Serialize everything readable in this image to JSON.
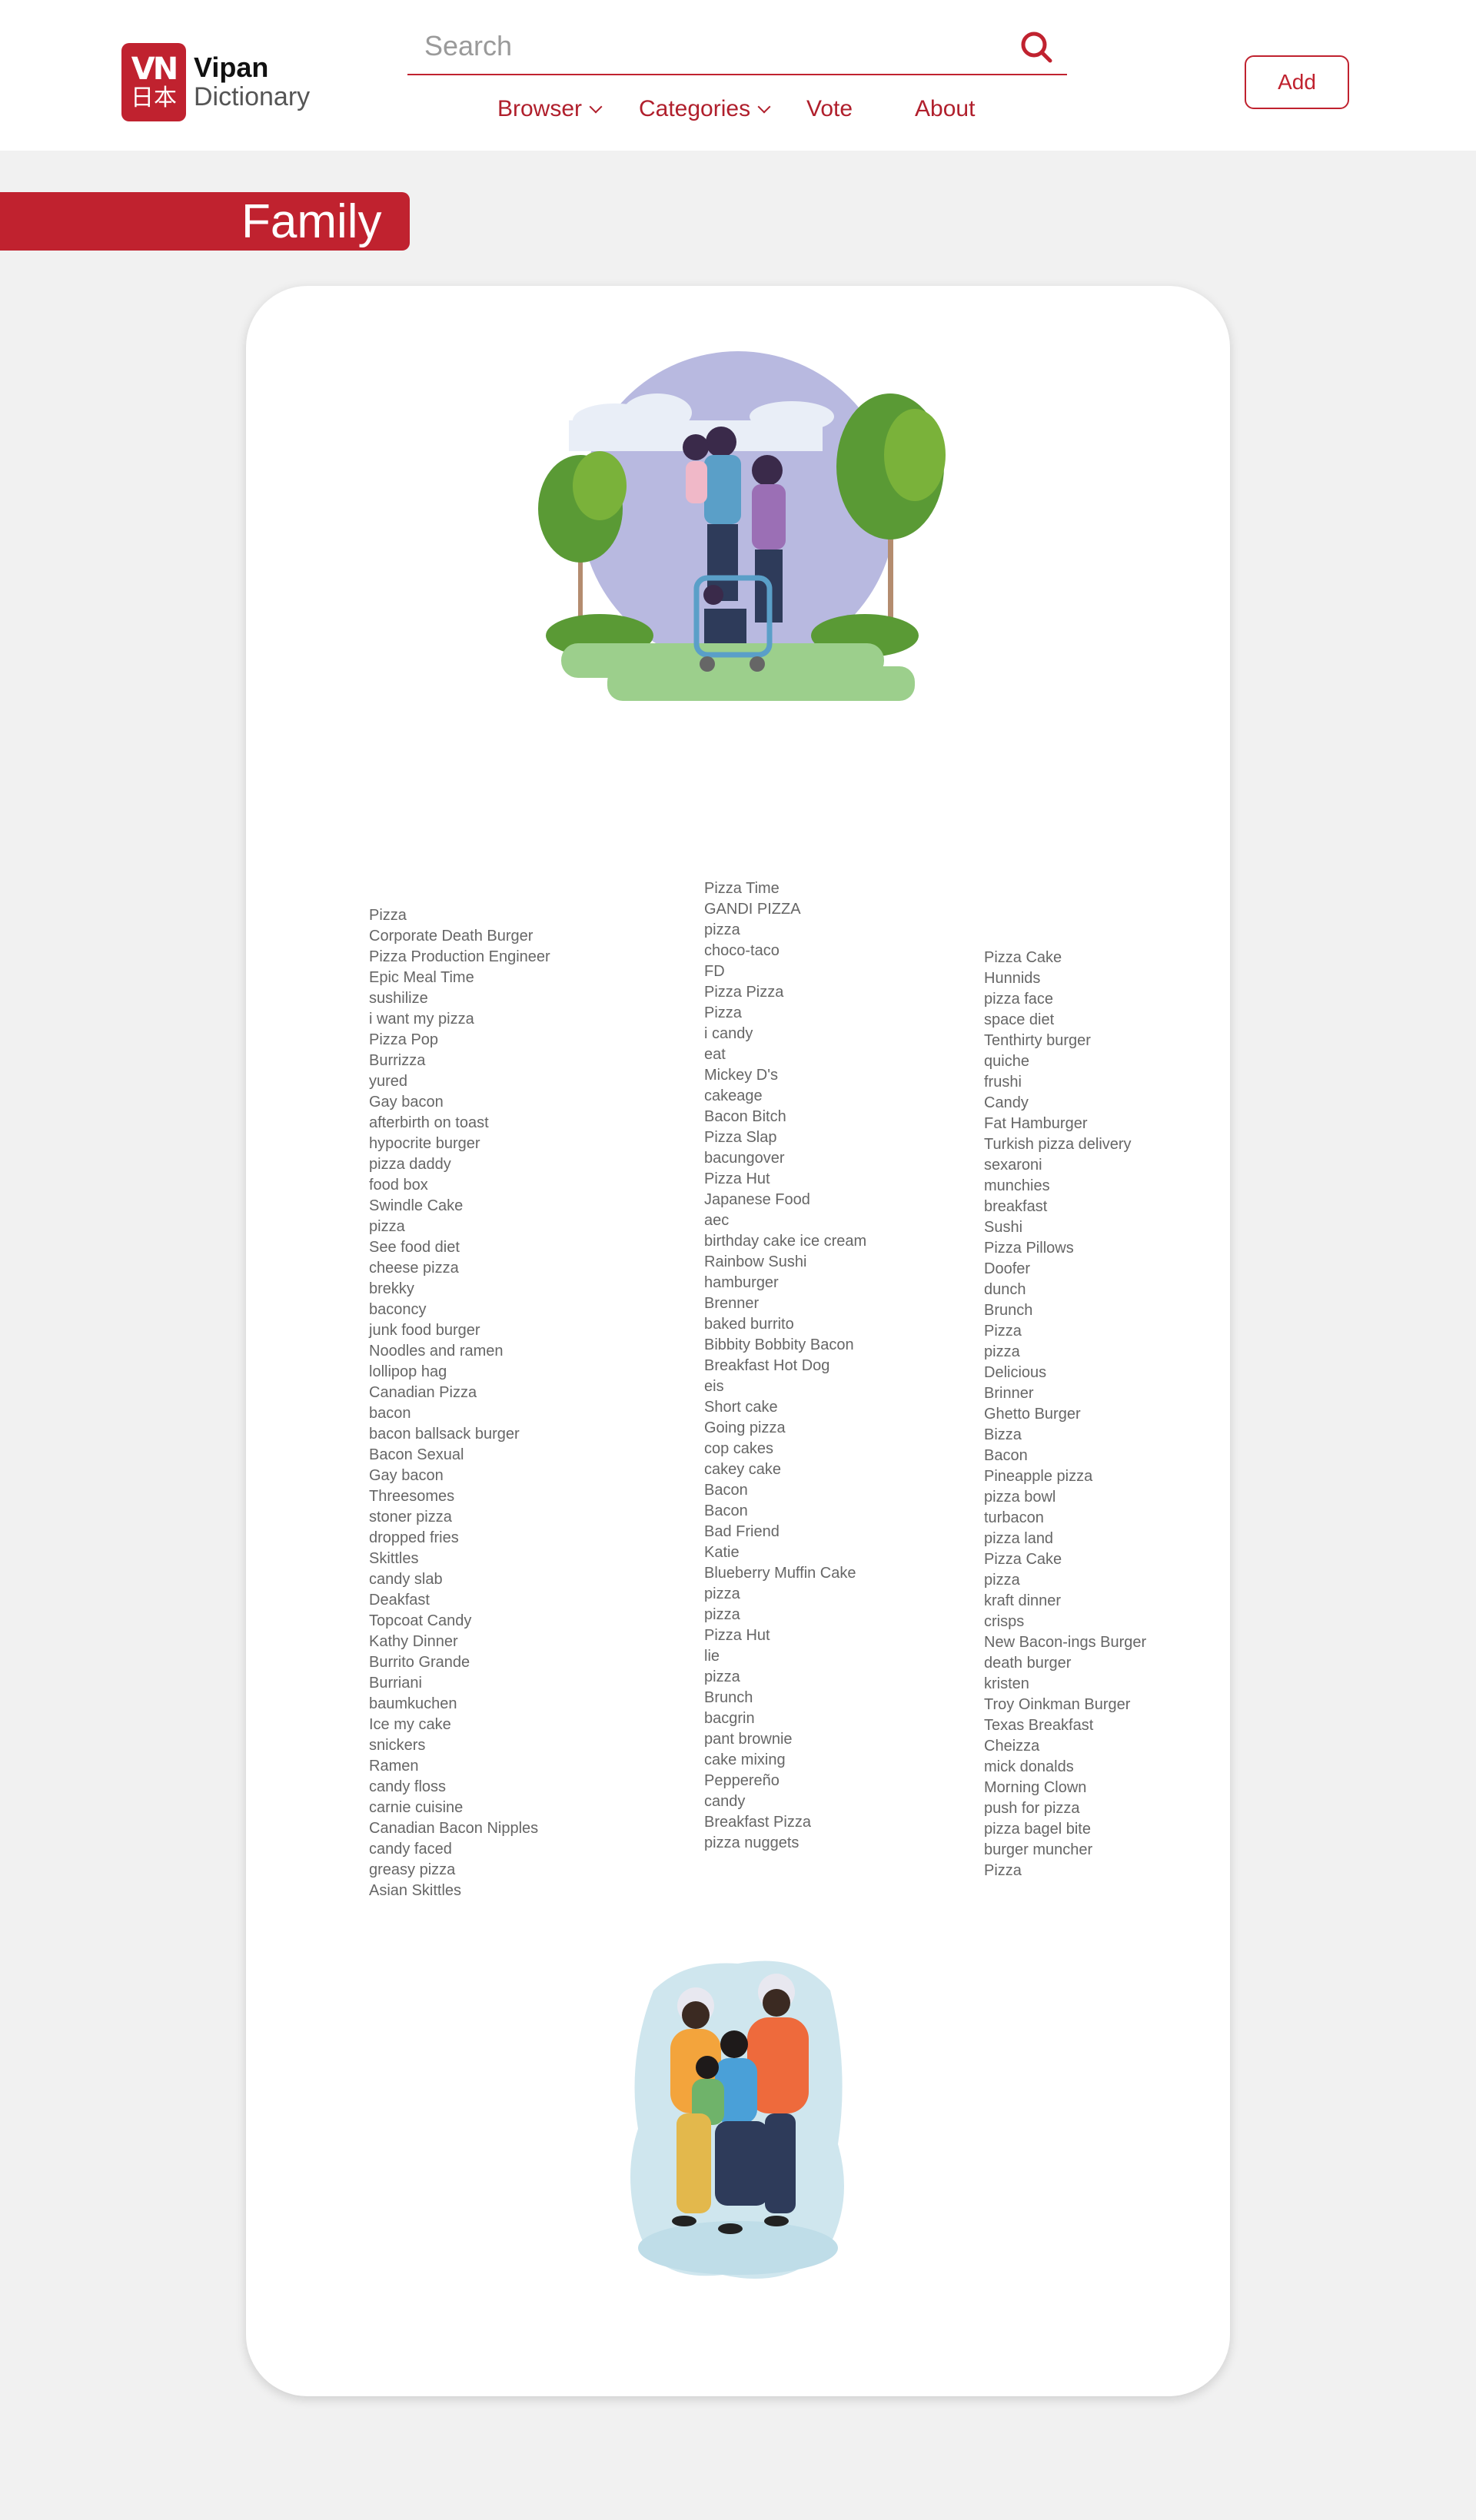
{
  "logo": {
    "badge_top": "VN",
    "badge_bottom": "日本",
    "brand": "Vipan",
    "subtitle": "Dictionary"
  },
  "search": {
    "placeholder": "Search",
    "value": ""
  },
  "nav": {
    "items": [
      {
        "label": "Browser",
        "dropdown": true
      },
      {
        "label": "Categories",
        "dropdown": true
      },
      {
        "label": "Vote",
        "dropdown": false
      },
      {
        "label": "About",
        "dropdown": false
      }
    ]
  },
  "header": {
    "add_label": "Add"
  },
  "page": {
    "title": "Family"
  },
  "colors": {
    "accent": "#c0222f",
    "background": "#f1f1f1",
    "card": "#ffffff",
    "text": "#666666"
  },
  "icons": [
    "search-icon",
    "chevron-down-icon"
  ],
  "words": {
    "column1": [
      "Pizza",
      "Corporate Death Burger",
      "Pizza Production Engineer",
      "Epic Meal Time",
      "sushilize",
      "i want my pizza",
      "Pizza Pop",
      "Burrizza",
      "yured",
      "Gay bacon",
      "afterbirth on toast",
      "hypocrite burger",
      "pizza daddy",
      "food box",
      "Swindle Cake",
      "pizza",
      "See food diet",
      "cheese pizza",
      "brekky",
      "baconcy",
      "junk food burger",
      "Noodles and ramen",
      "lollipop hag",
      "Canadian Pizza",
      "bacon",
      "bacon ballsack burger",
      "Bacon Sexual",
      "Gay bacon",
      "Threesomes",
      "stoner pizza",
      "dropped fries",
      "Skittles",
      "candy slab",
      "Deakfast",
      "Topcoat Candy",
      "Kathy Dinner",
      "Burrito Grande",
      "Burriani",
      "baumkuchen",
      "Ice my cake",
      "snickers",
      "Ramen",
      "candy floss",
      "carnie cuisine",
      "Canadian Bacon Nipples",
      "candy faced",
      "greasy pizza",
      "Asian Skittles"
    ],
    "column2": [
      "Pizza Time",
      "GANDI PIZZA",
      "pizza",
      "choco-taco",
      "FD",
      "Pizza Pizza",
      "Pizza",
      "i candy",
      "eat",
      "Mickey D's",
      "cakeage",
      "Bacon Bitch",
      "Pizza Slap",
      "bacungover",
      "Pizza Hut",
      "Japanese Food",
      "aec",
      "birthday cake ice cream",
      "Rainbow Sushi",
      "hamburger",
      "Brenner",
      "baked burrito",
      "Bibbity Bobbity Bacon",
      "Breakfast Hot Dog",
      "eis",
      "Short cake",
      "Going pizza",
      "cop cakes",
      "cakey cake",
      "Bacon",
      "Bacon",
      "Bad Friend",
      "Katie",
      "Blueberry Muffin Cake",
      "pizza",
      "pizza",
      "Pizza Hut",
      "lie",
      "pizza",
      "Brunch",
      "bacgrin",
      "pant brownie",
      "cake mixing",
      "Peppereño",
      "candy",
      "Breakfast Pizza",
      "pizza nuggets"
    ],
    "column3": [
      "Pizza Cake",
      "Hunnids",
      "pizza face",
      "space diet",
      "Tenthirty burger",
      "quiche",
      "frushi",
      "Candy",
      "Fat Hamburger",
      "Turkish pizza delivery",
      "sexaroni",
      "munchies",
      "breakfast",
      "Sushi",
      "Pizza Pillows",
      "Doofer",
      "dunch",
      "Brunch",
      "Pizza",
      "pizza",
      "Delicious",
      "Brinner",
      "Ghetto Burger",
      "Bizza",
      "Bacon",
      "Pineapple pizza",
      "pizza bowl",
      "turbacon",
      "pizza land",
      "Pizza Cake",
      "pizza",
      "kraft dinner",
      "crisps",
      "New Bacon-ings Burger",
      "death burger",
      "kristen",
      "Troy Oinkman Burger",
      "Texas Breakfast",
      "Cheizza",
      "mick donalds",
      "Morning Clown",
      "push for pizza",
      "pizza bagel bite",
      "burger muncher",
      "Pizza"
    ]
  }
}
